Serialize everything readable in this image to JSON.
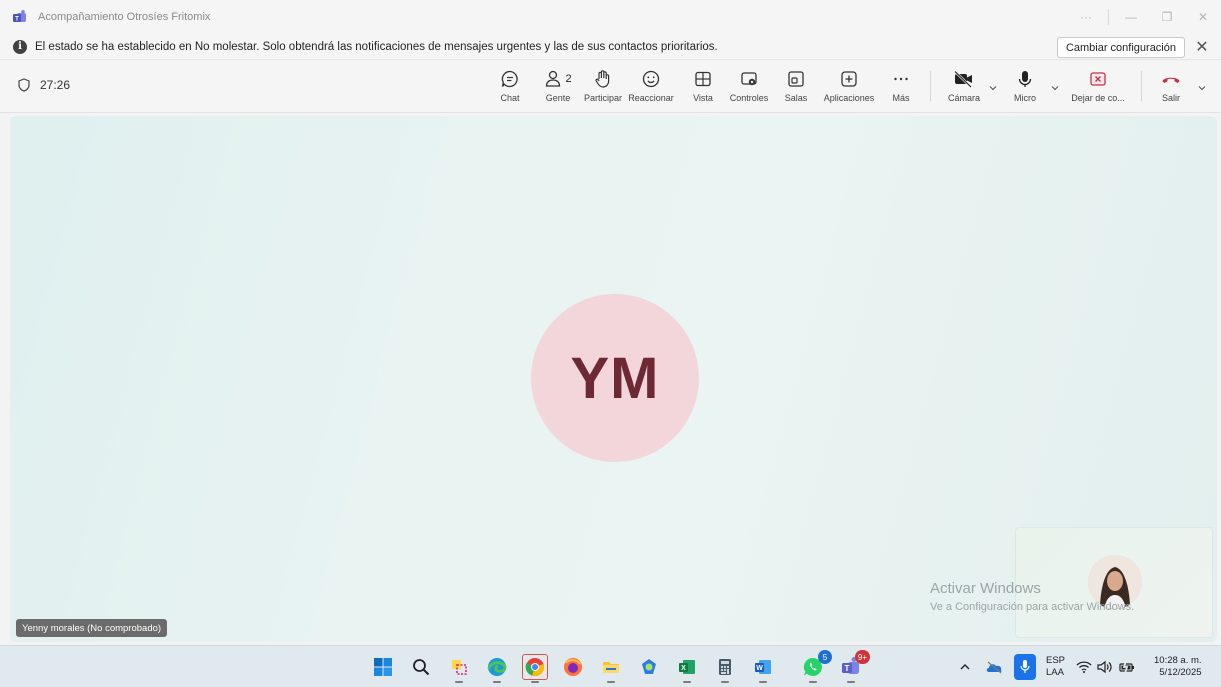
{
  "window": {
    "title": "Acompañamiento Otrosíes Fritomix"
  },
  "notification": {
    "message": "El estado se ha establecido en No molestar. Solo obtendrá las notificaciones de mensajes urgentes y las de sus contactos prioritarios.",
    "change_settings_label": "Cambiar configuración"
  },
  "toolbar": {
    "timer": "27:26",
    "people_count": "2",
    "buttons": {
      "chat": "Chat",
      "people": "Gente",
      "raise": "Participar",
      "react": "Reaccionar",
      "view": "Vista",
      "controls": "Controles",
      "rooms": "Salas",
      "apps": "Aplicaciones",
      "more": "Más",
      "camera": "Cámara",
      "mic": "Micro",
      "stop_share": "Dejar de co...",
      "leave": "Salir"
    }
  },
  "stage": {
    "participant_initials": "YM",
    "participant_name_tag": "Yenny morales (No comprobado)"
  },
  "watermark": {
    "line1": "Activar Windows",
    "line2": "Ve a Configuración para activar Windows."
  },
  "taskbar": {
    "whatsapp_badge": "5",
    "teams_badge": "9+",
    "lang_line1": "ESP",
    "lang_line2": "LAA",
    "time": "10:28 a. m.",
    "date": "5/12/2025"
  },
  "colors": {
    "leave_red": "#c4314b",
    "avatar_bg": "#f3d6d9",
    "avatar_text": "#6e2a34",
    "teams_purple": "#5b5fc7"
  }
}
